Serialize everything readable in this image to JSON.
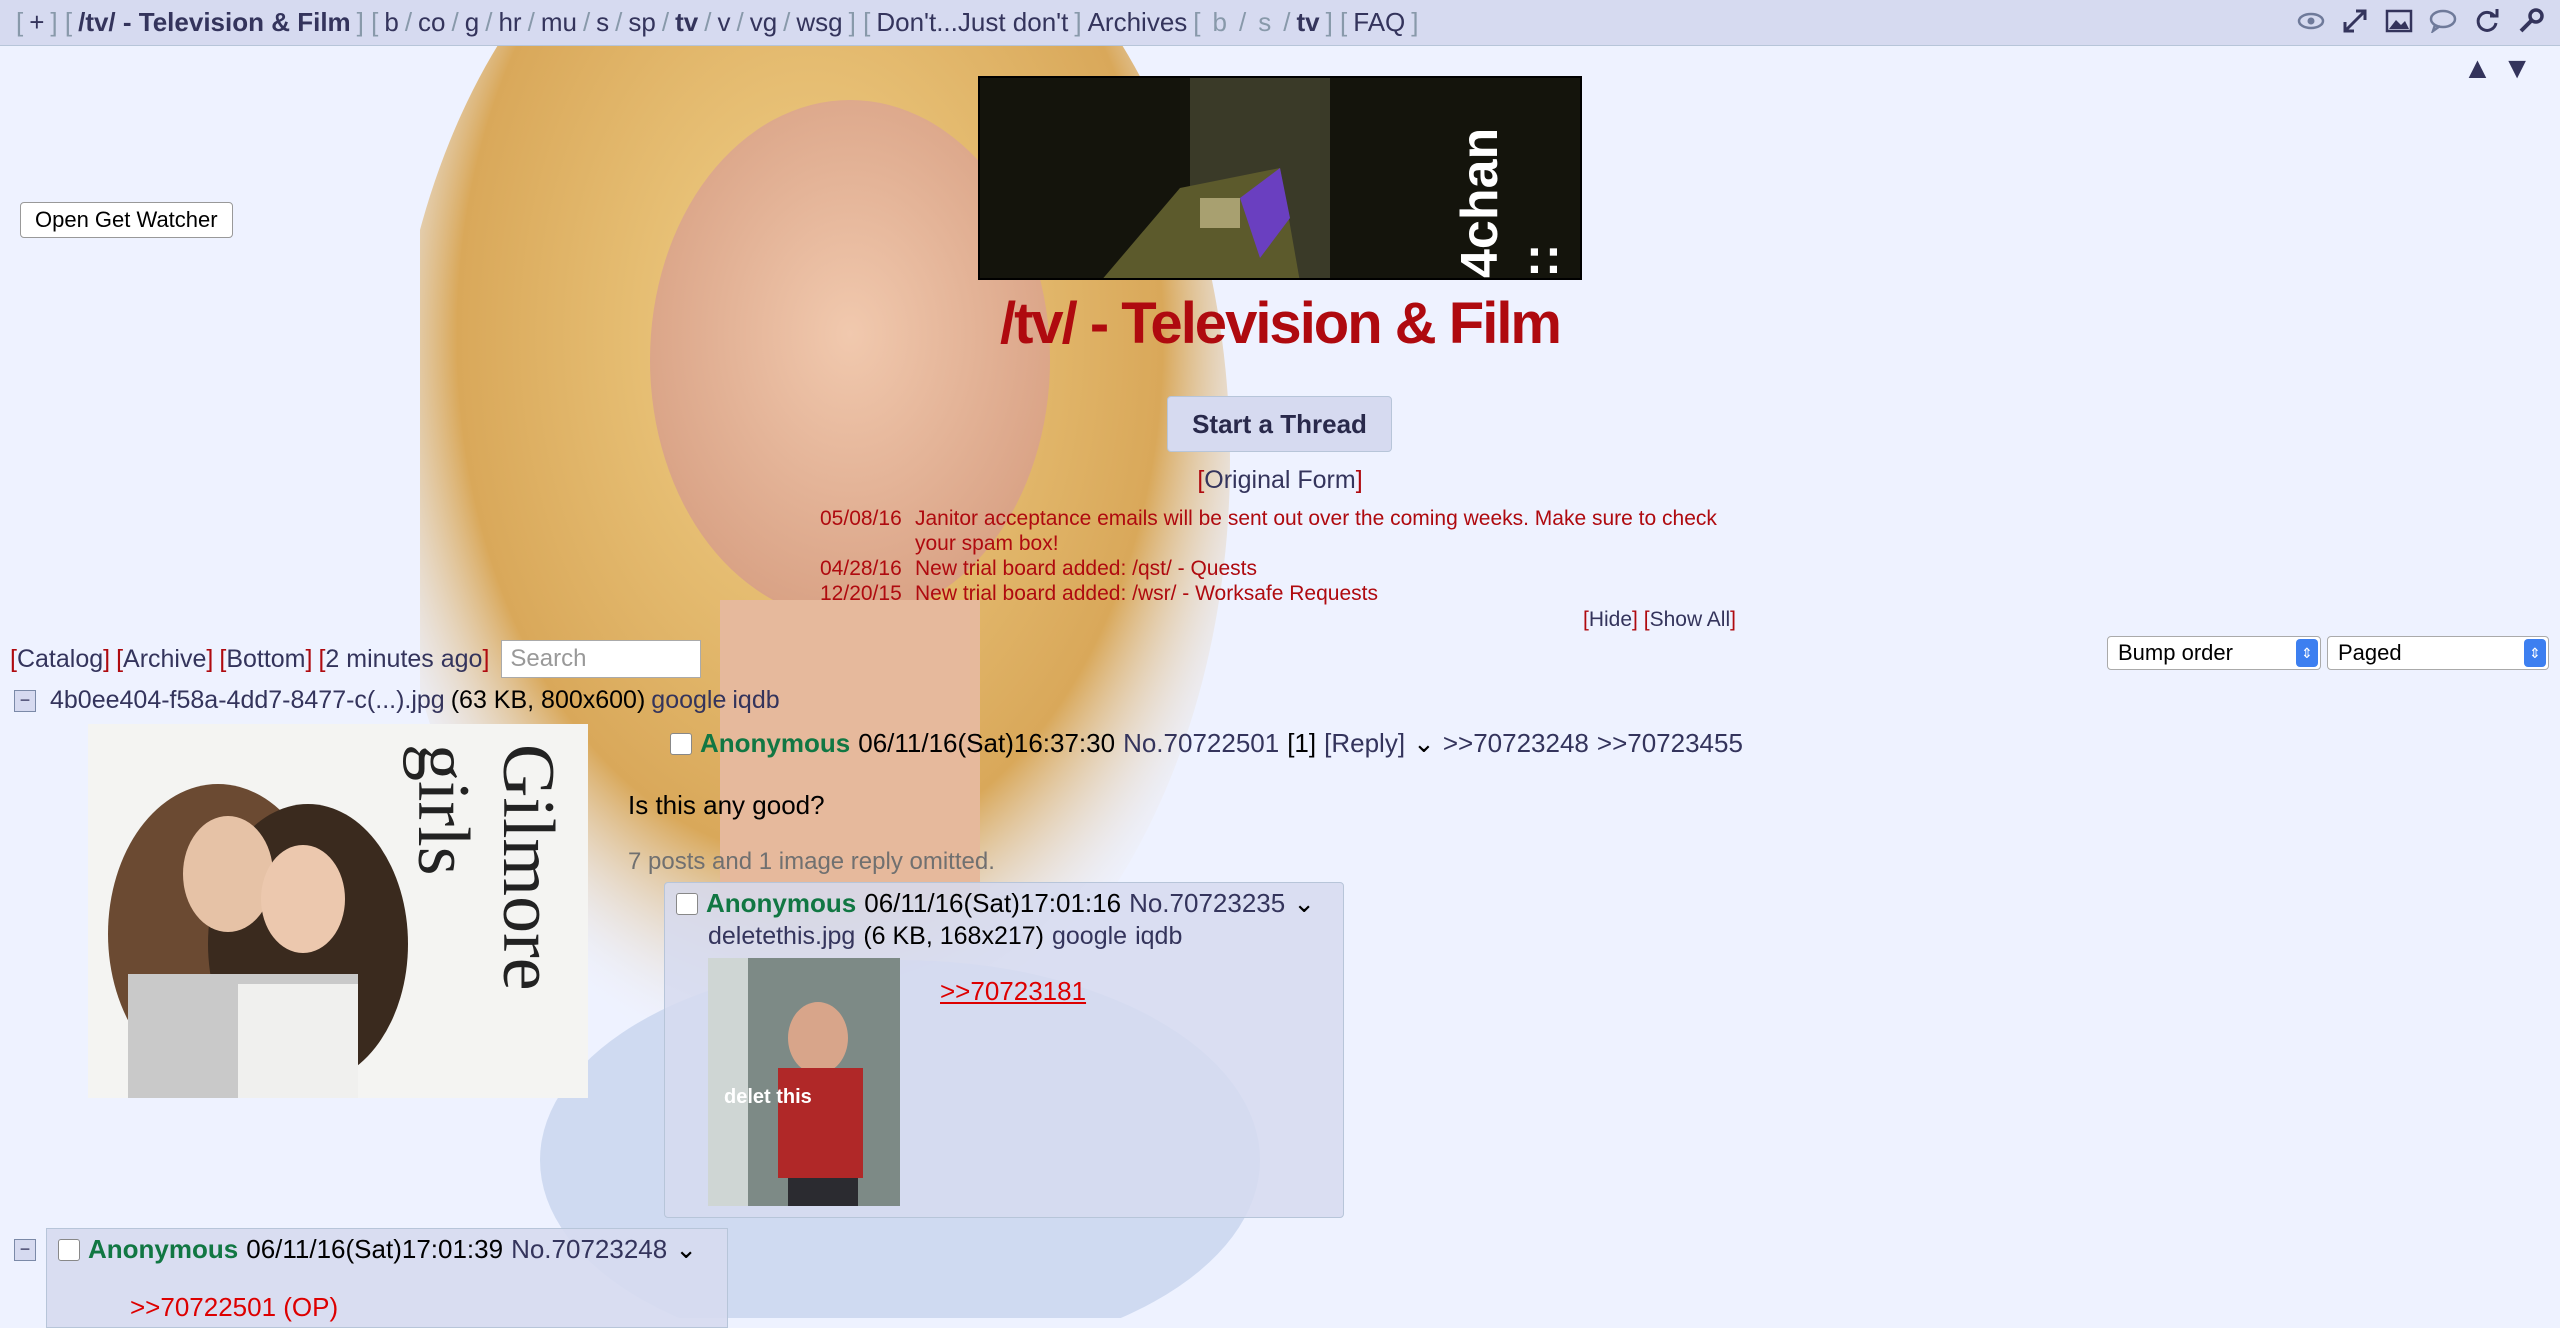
{
  "topnav": {
    "add": "+",
    "current_board": "/tv/ - Television & Film",
    "boards": [
      "b",
      "co",
      "g",
      "hr",
      "mu",
      "s",
      "sp",
      "tv",
      "v",
      "vg",
      "wsg"
    ],
    "custom_link": "Don't...Just don't",
    "archives_label": "Archives",
    "archive_boards": [
      "b",
      "s",
      "tv"
    ],
    "faq": "FAQ",
    "icons": [
      "eye-icon",
      "expand-icon",
      "image-icon",
      "speech-bubble-icon",
      "refresh-icon",
      "wrench-icon"
    ]
  },
  "scroll_arrows": {
    "up": "▲",
    "down": "▼"
  },
  "watcher_button": "Open Get Watcher",
  "banner": {
    "logo_text": "4chan ::"
  },
  "board_title": "/tv/ - Television & Film",
  "start_thread": "Start a Thread",
  "original_form": "Original Form",
  "announcements": [
    {
      "date": "05/08/16",
      "text": "Janitor acceptance emails will be sent out over the coming weeks. Make sure to check your spam box!"
    },
    {
      "date": "04/28/16",
      "text": "New trial board added: /qst/ - Quests"
    },
    {
      "date": "12/20/15",
      "text": "New trial board added: /wsr/ - Worksafe Requests"
    }
  ],
  "ann_controls": {
    "hide": "Hide",
    "show_all": "Show All"
  },
  "board_nav": {
    "catalog": "Catalog",
    "archive": "Archive",
    "bottom": "Bottom",
    "updated": "2 minutes ago",
    "search_placeholder": "Search"
  },
  "sort_select": {
    "value": "Bump order"
  },
  "view_select": {
    "value": "Paged"
  },
  "op": {
    "minus": "−",
    "filename": "4b0ee404-f58a-4dd7-8477-c(...).jpg",
    "fileinfo": "(63 KB, 800x600)",
    "google": "google",
    "iqdb": "iqdb",
    "thumb_text": "Gilmore girls",
    "name": "Anonymous",
    "datetime": "06/11/16(Sat)16:37:30",
    "number": "No.70722501",
    "reply_count": "[1]",
    "reply_link": "[Reply]",
    "menu": "⌄",
    "backlinks": [
      ">>70723248",
      ">>70723455"
    ],
    "comment": "Is this any good?",
    "omitted": "7 posts and 1 image reply omitted."
  },
  "reply1": {
    "name": "Anonymous",
    "datetime": "06/11/16(Sat)17:01:16",
    "number": "No.70723235",
    "menu": "⌄",
    "filename": "deletethis.jpg",
    "fileinfo": "(6 KB, 168x217)",
    "google": "google",
    "iqdb": "iqdb",
    "thumb_text": "delet this",
    "quote": ">>70723181"
  },
  "reply2": {
    "minus": "−",
    "name": "Anonymous",
    "datetime": "06/11/16(Sat)17:01:39",
    "number": "No.70723248",
    "menu": "⌄",
    "quote": ">>70722501 (OP)"
  }
}
